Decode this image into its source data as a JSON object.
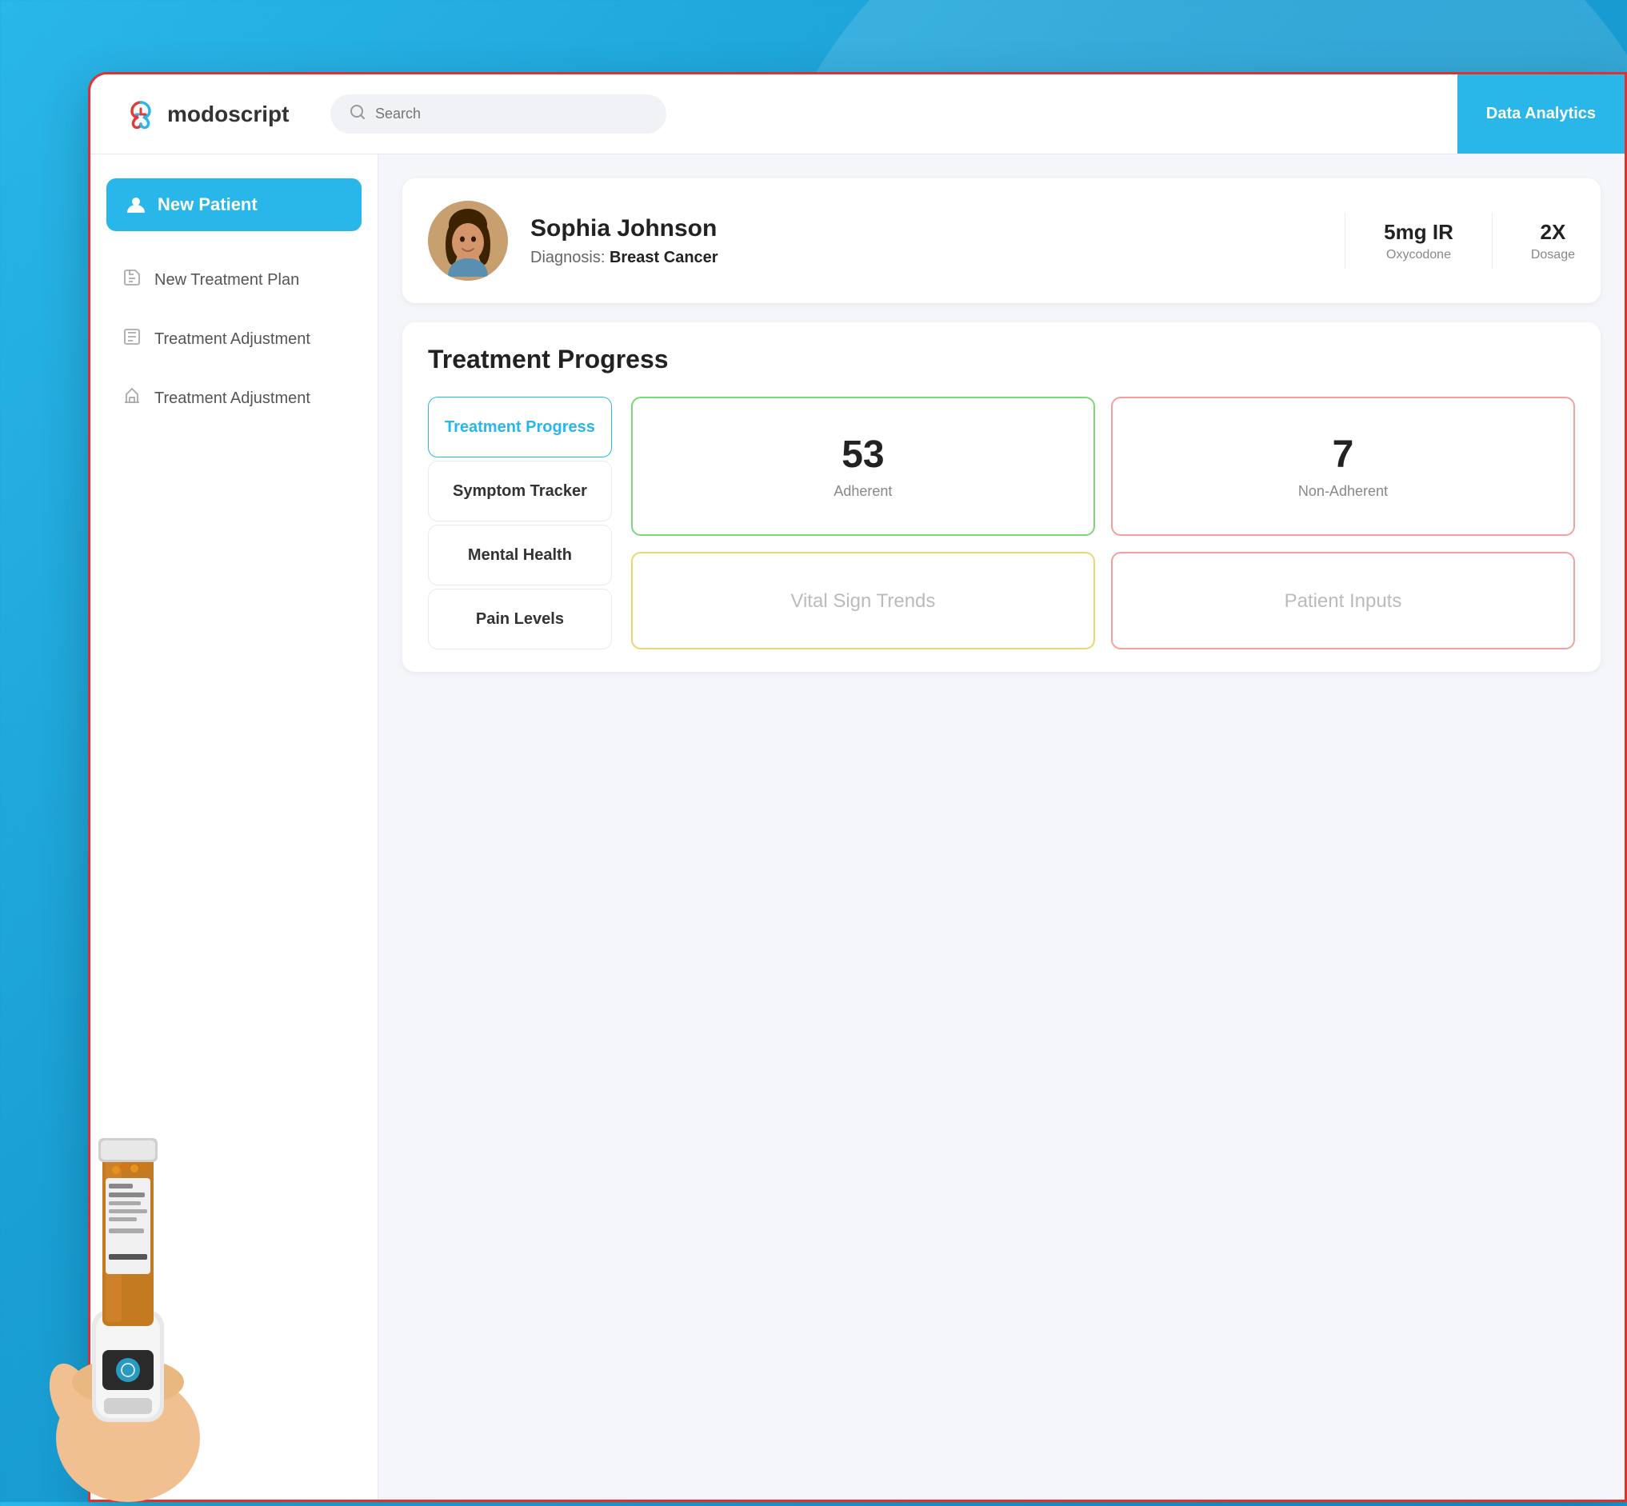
{
  "app": {
    "name_prefix": "modo",
    "name_suffix": "script"
  },
  "header": {
    "search_placeholder": "Search",
    "data_analytics_label": "Data Analytics"
  },
  "sidebar": {
    "new_patient_label": "New Patient",
    "items": [
      {
        "id": "new-treatment-plan",
        "label": "New Treatment Plan",
        "icon": "📋"
      },
      {
        "id": "treatment-adjustment-1",
        "label": "Treatment Adjustment",
        "icon": "📄"
      },
      {
        "id": "treatment-adjustment-2",
        "label": "Treatment Adjustment",
        "icon": "📊"
      }
    ]
  },
  "patient": {
    "name": "Sophia Johnson",
    "diagnosis_label": "Diagnosis:",
    "diagnosis_value": "Breast Cancer",
    "medication_dose": "5mg IR",
    "medication_name": "Oxycodone",
    "dosage_label": "Dosage",
    "dosage_value": "2X"
  },
  "treatment": {
    "section_title": "Treatment  Progress",
    "tabs": [
      {
        "id": "treatment-progress",
        "label": "Treatment Progress",
        "active": true
      },
      {
        "id": "symptom-tracker",
        "label": "Symptom Tracker",
        "active": false
      },
      {
        "id": "mental-health",
        "label": "Mental Health",
        "active": false
      },
      {
        "id": "pain-levels",
        "label": "Pain Levels",
        "active": false
      }
    ],
    "stats": [
      {
        "id": "adherent",
        "value": "53",
        "label": "Adherent",
        "color": "green"
      },
      {
        "id": "non-adherent",
        "value": "7",
        "label": "Non-Adherent",
        "color": "red"
      },
      {
        "id": "vital-signs",
        "value": "",
        "label": "Vital Sign Trends",
        "color": "yellow"
      },
      {
        "id": "patient-inputs",
        "value": "",
        "label": "Patient Inputs",
        "color": "pink"
      }
    ]
  },
  "colors": {
    "brand_blue": "#29b6e8",
    "red_border": "#e03030",
    "green_card": "#7dd67a",
    "red_card": "#f4a0a0",
    "yellow_card": "#e8d870"
  }
}
